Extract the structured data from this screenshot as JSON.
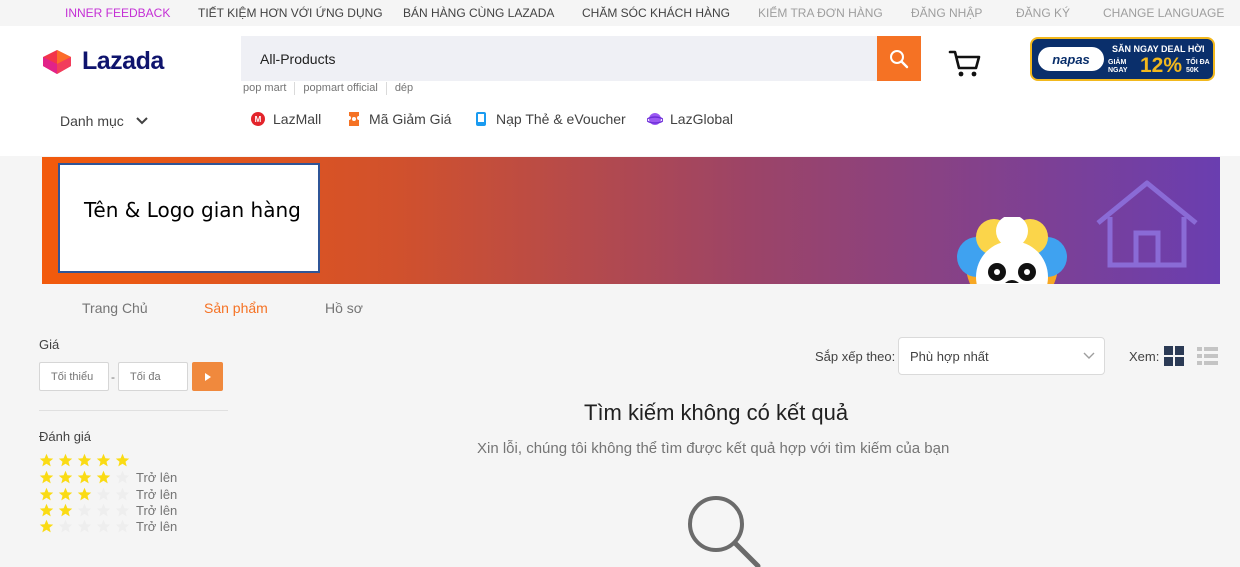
{
  "topbar": {
    "links": [
      "INNER FEEDBACK",
      "TIẾT KIỆM HƠN VỚI ỨNG DỤNG",
      "BÁN HÀNG CÙNG LAZADA",
      "CHĂM SÓC KHÁCH HÀNG",
      "KIỂM TRA ĐƠN HÀNG",
      "ĐĂNG NHẬP",
      "ĐĂNG KÝ",
      "CHANGE LANGUAGE"
    ]
  },
  "header": {
    "logo_text": "Lazada",
    "search_value": "All-Products",
    "search_hints": [
      "pop mart",
      "popmart official",
      "dép"
    ],
    "promo": {
      "brand": "napas",
      "headline": "SĂN NGAY DEAL HỜI",
      "giam": "GIẢM NGAY",
      "percent": "12%",
      "max": "TỐI ĐA 50K"
    },
    "category_label": "Danh mục",
    "quick_links": [
      "LazMall",
      "Mã Giảm Giá",
      "Nạp Thẻ & eVoucher",
      "LazGlobal"
    ]
  },
  "banner": {
    "shop_name": "Tên & Logo gian hàng"
  },
  "tabs": [
    "Trang Chủ",
    "Sản phẩm",
    "Hồ sơ"
  ],
  "tabs_active_index": 1,
  "filters": {
    "price_label": "Giá",
    "min_placeholder": "Tối thiểu",
    "max_placeholder": "Tối đa",
    "price_separator": "-",
    "rating_label": "Đánh giá",
    "rating_suffix": "Trở lên",
    "ratings": [
      5,
      4,
      3,
      2,
      1
    ]
  },
  "sort": {
    "label": "Sắp xếp theo:",
    "selected": "Phù hợp nhất",
    "view_label": "Xem:"
  },
  "empty": {
    "title": "Tìm kiếm không có kết quả",
    "subtitle": "Xin lỗi, chúng tôi không thể tìm được kết quả hợp với tìm kiếm của bạn"
  },
  "colors": {
    "accent": "#f57224",
    "star_on": "#fadb14",
    "star_off": "#eeeeee",
    "brand_navy": "#0f146d"
  }
}
